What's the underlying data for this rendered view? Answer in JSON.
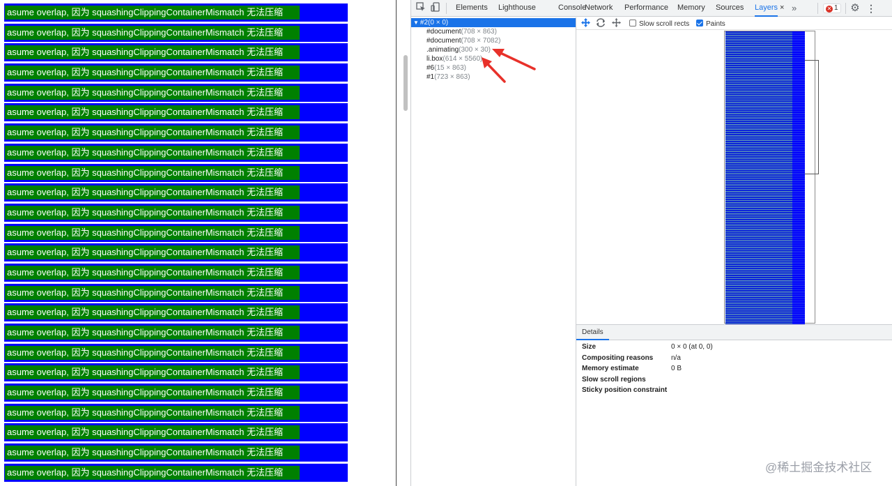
{
  "page": {
    "box_text": "asume overlap, 因为 squashingClippingContainerMismatch 无法压缩",
    "box_count": 24,
    "colors": {
      "outer": "#0000ff",
      "inner": "#008000",
      "text": "#ffffff"
    }
  },
  "devtools": {
    "icons": {
      "inspect": "inspect-element-icon",
      "device": "device-toolbar-icon",
      "more_tabs": "more-tabs-icon",
      "settings": "settings-gear-icon",
      "menu": "kebab-menu-icon"
    },
    "tabs": [
      {
        "label": "Elements"
      },
      {
        "label": "Lighthouse"
      },
      {
        "label": "Console"
      },
      {
        "label": "Network"
      },
      {
        "label": "Performance"
      },
      {
        "label": "Memory"
      },
      {
        "label": "Sources"
      },
      {
        "label": "Layers",
        "active": true
      }
    ],
    "close_glyph": "×",
    "more_glyph": "»",
    "error_count": "1",
    "layers": [
      {
        "name": "#2",
        "dims": "(0 × 0)",
        "selected": true,
        "expander": "▼"
      },
      {
        "name": "#document",
        "dims": "(708 × 863)"
      },
      {
        "name": "#document",
        "dims": "(708 × 7082)"
      },
      {
        "name": ".animating",
        "dims": "(300 × 30)"
      },
      {
        "name": "li.box",
        "dims": "(614 × 5560)"
      },
      {
        "name": "#6",
        "dims": "(15 × 863)"
      },
      {
        "name": "#1",
        "dims": "(723 × 863)"
      }
    ],
    "viewer": {
      "slow_scroll_label": "Slow scroll rects",
      "slow_scroll_checked": false,
      "paints_label": "Paints",
      "paints_checked": true
    },
    "details": {
      "tab_label": "Details",
      "rows": [
        {
          "key": "Size",
          "value": "0 × 0 (at 0, 0)"
        },
        {
          "key": "Compositing reasons",
          "value": "n/a"
        },
        {
          "key": "Memory estimate",
          "value": "0 B"
        },
        {
          "key": "Slow scroll regions",
          "value": ""
        },
        {
          "key": "Sticky position constraint",
          "value": ""
        }
      ]
    }
  },
  "watermark": "@稀土掘金技术社区",
  "annotation_color": "#e8312a"
}
